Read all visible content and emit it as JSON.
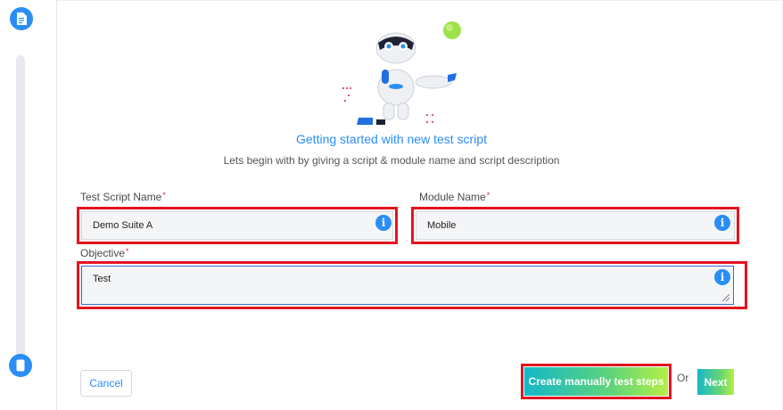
{
  "rail": {
    "top_icon": "document-icon",
    "bottom_icon": "mobile-icon"
  },
  "header": {
    "title": "Getting started with new test script",
    "subtitle": "Lets begin with by giving a script & module name and script description"
  },
  "form": {
    "script_name": {
      "label": "Test Script Name",
      "required_mark": "*",
      "value": "Demo Suite A",
      "info_glyph": "i"
    },
    "module_name": {
      "label": "Module Name",
      "required_mark": "*",
      "value": "Mobile",
      "info_glyph": "i"
    },
    "objective": {
      "label": "Objective",
      "required_mark": "*",
      "value": "Test",
      "info_glyph": "i"
    }
  },
  "actions": {
    "cancel_label": "Cancel",
    "create_label": "Create manually test steps",
    "or_label": "Or",
    "next_label": "Next"
  },
  "colors": {
    "accent": "#2a8ef6",
    "highlight": "#e3141f",
    "gradient_start": "#14b8c9",
    "gradient_end": "#b6f046"
  }
}
